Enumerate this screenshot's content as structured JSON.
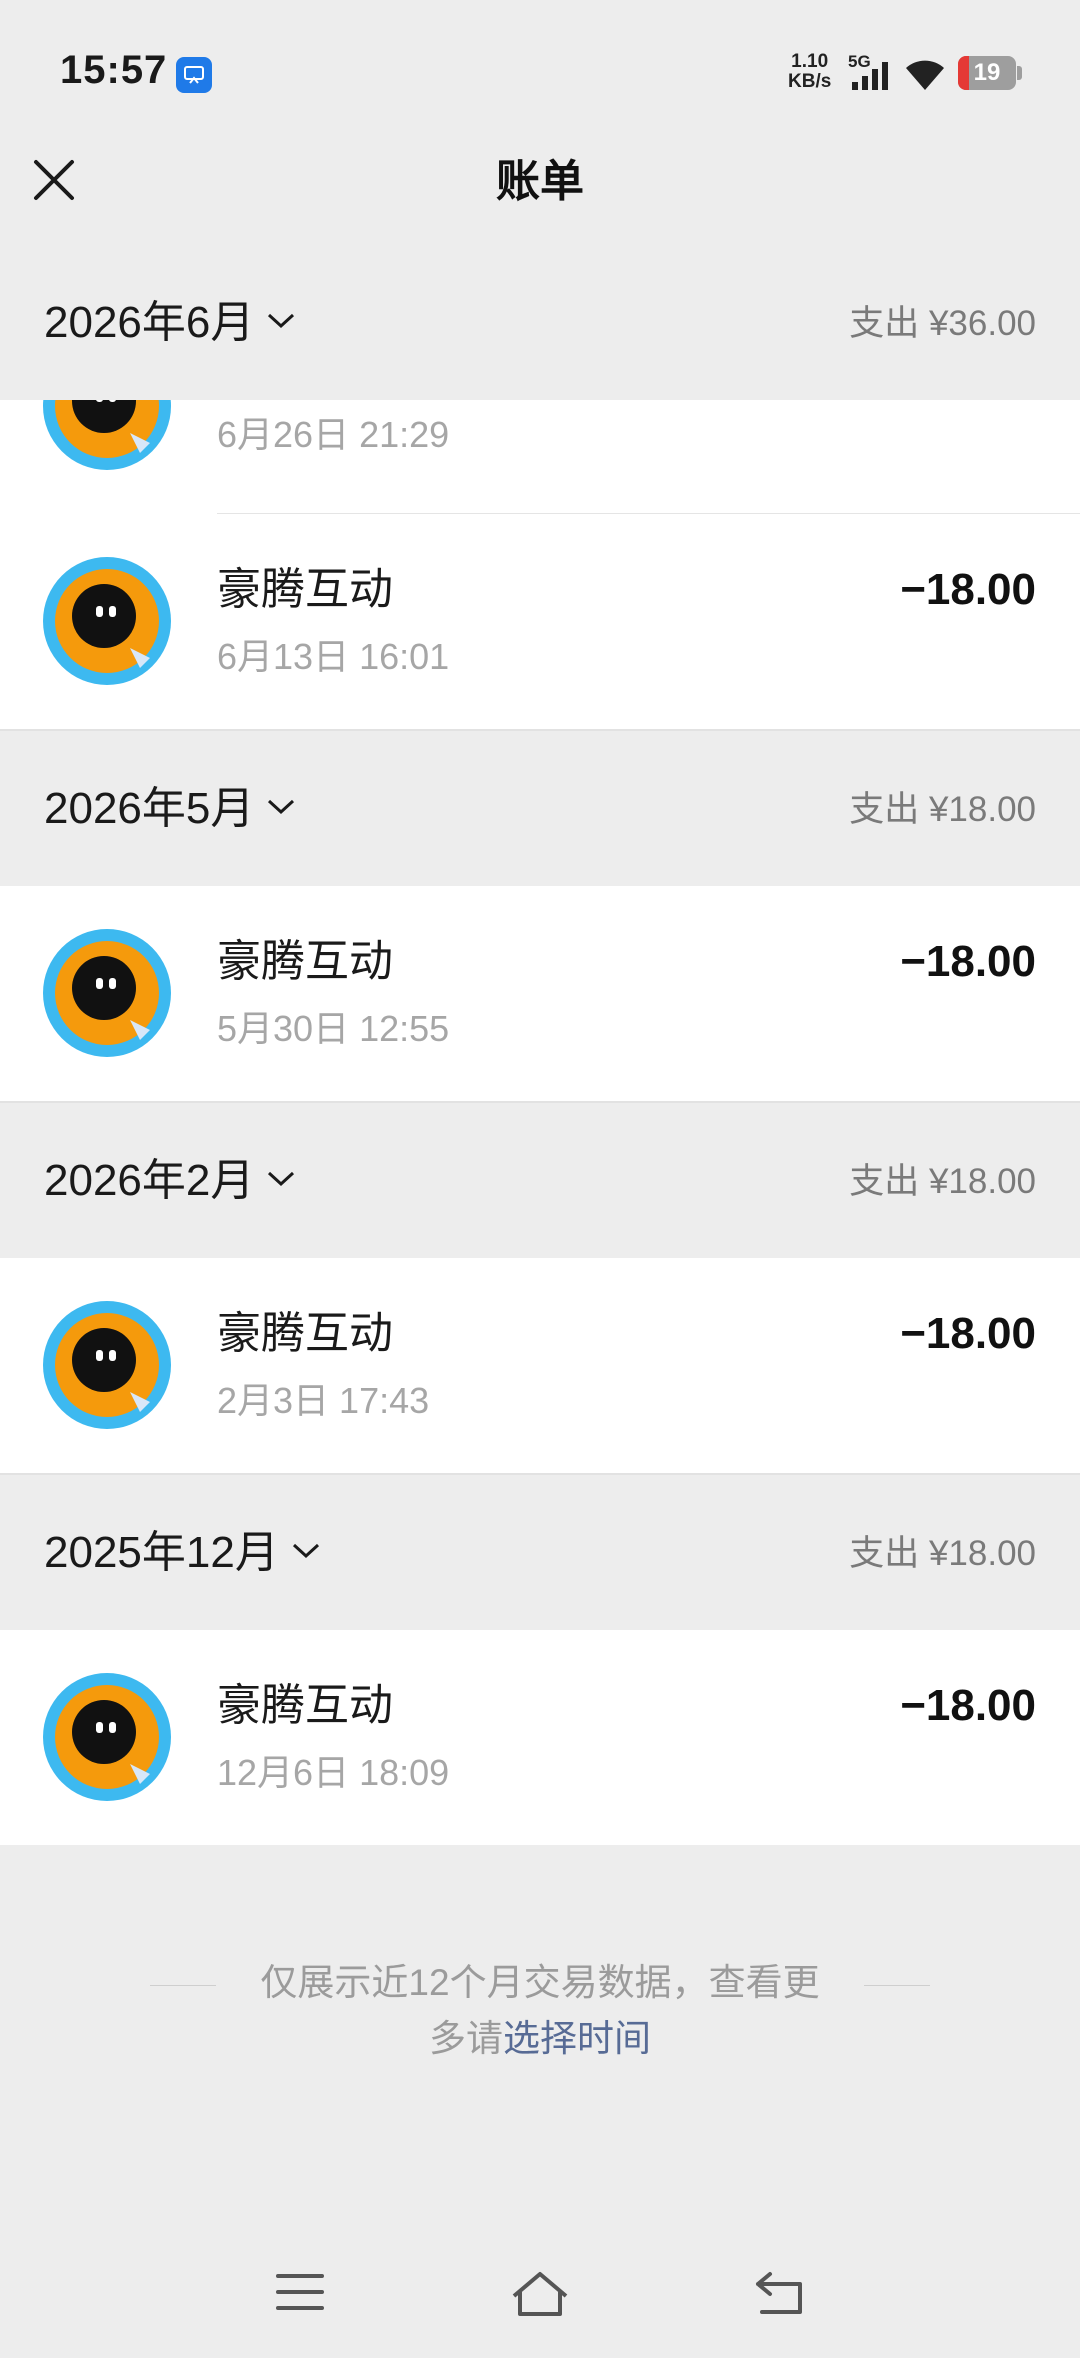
{
  "status_bar": {
    "time": "15:57",
    "net_speed_value": "1.10",
    "net_speed_unit": "KB/s",
    "network": "5G",
    "battery": "19",
    "battery_level": 0.19,
    "battery_color": "#e53935"
  },
  "nav": {
    "title": "账单",
    "close_icon": "close-icon"
  },
  "sections": [
    {
      "month": "2026年6月",
      "total": "支出 ¥36.00",
      "transactions": [
        {
          "name": "",
          "time": "6月26日 21:29",
          "amount": ""
        },
        {
          "name": "豪腾互动",
          "time": "6月13日 16:01",
          "amount": "−18.00"
        }
      ]
    },
    {
      "month": "2026年5月",
      "total": "支出 ¥18.00",
      "transactions": [
        {
          "name": "豪腾互动",
          "time": "5月30日 12:55",
          "amount": "−18.00"
        }
      ]
    },
    {
      "month": "2026年2月",
      "total": "支出 ¥18.00",
      "transactions": [
        {
          "name": "豪腾互动",
          "time": "2月3日 17:43",
          "amount": "−18.00"
        }
      ]
    },
    {
      "month": "2025年12月",
      "total": "支出 ¥18.00",
      "transactions": [
        {
          "name": "豪腾互动",
          "time": "12月6日 18:09",
          "amount": "−18.00"
        }
      ]
    }
  ],
  "footer": {
    "line1": "仅展示近12个月交易数据，查看更",
    "line2_prefix": "多请",
    "link": "选择时间"
  },
  "system_nav": {
    "menu_icon": "menu-icon",
    "home_icon": "home-icon",
    "back_icon": "back-icon"
  },
  "colors": {
    "background": "#ededed",
    "link": "#576b95",
    "avatar_ring": "#3db9f0",
    "avatar_body": "#f59a0c"
  }
}
